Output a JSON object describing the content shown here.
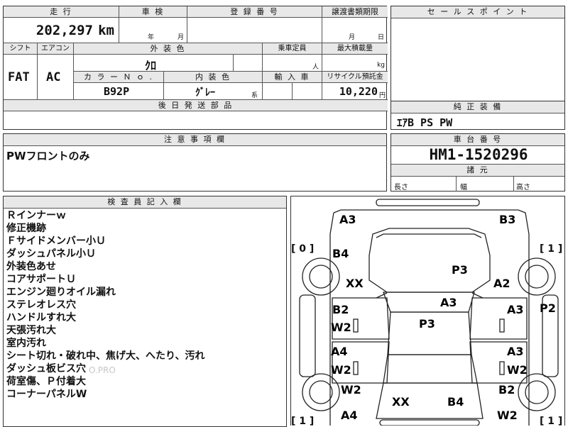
{
  "sheet": {
    "mileage_hdr": "走 行",
    "mileage": "202,297",
    "mileage_unit": "km",
    "inspection_hdr": "車 検",
    "inspection_year": "年",
    "inspection_month": "月",
    "reg_hdr": "登 録 番 号",
    "transfer_hdr": "譲渡書類期限",
    "transfer_month": "月",
    "transfer_day": "日",
    "shift_hdr": "シフト",
    "aircon_hdr": "エアコン",
    "color_hdr": "外 装 色",
    "capacity_hdr": "乗車定員",
    "load_hdr": "最大積載量",
    "shift": "FAT",
    "aircon": "AC",
    "color": "ｸﾛ",
    "capacity_unit": "人",
    "load_unit": "kg",
    "colorno_hdr": "カ ラ ー Ｎ ｏ .",
    "interior_hdr": "内 装 色",
    "import_hdr": "輸 入 車",
    "recycle_hdr": "リサイクル預託金",
    "colorno": "B92P",
    "interior": "ｸﾞﾚｰ",
    "interior_unit": "系",
    "recycle": "10,220",
    "recycle_unit": "円",
    "parts_hdr": "後 日 発 送 部 品"
  },
  "sales": {
    "hdr": "セ ー ル ス ポ イ ン ト"
  },
  "equip": {
    "hdr": "純 正 装 備",
    "value": "ｴｱB PS PW"
  },
  "notes": {
    "hdr": "注 意 事 項 欄",
    "value": "PWフロントのみ"
  },
  "chassis": {
    "hdr": "車 台 番 号",
    "value": "HM1-1520296",
    "dims_hdr": "諸 元",
    "length": "長さ",
    "width": "幅",
    "height": "高さ"
  },
  "inspector": {
    "hdr": "検 査 員 記 入 欄",
    "lines": [
      "Ｒインナーｗ",
      "修正機跡",
      "Ｆサイドメンバー小Ｕ",
      "ダッシュパネル小Ｕ",
      "外装色あせ",
      "コアサポートＵ",
      "エンジン廻りオイル漏れ",
      "ステレオレス穴",
      "ハンドルすれ大",
      "天張汚れ大",
      "室内汚れ",
      "シート切れ・破れ中、焦げ大、へたり、汚れ",
      "ダッシュ板ビス穴",
      "荷室傷、Ｐ付着大",
      "コーナーパネルW"
    ]
  },
  "watermark": "O.PRO",
  "diagram": {
    "codes": {
      "a3_front_left": "A3",
      "b3_front_right": "B3",
      "b4_left": "B4",
      "p3_hood": "P3",
      "xx_left": "XX",
      "a2_right": "A2",
      "a3_center": "A3",
      "p3_roof": "P3",
      "b2_left_front_door": "B2",
      "w2_left_front_door": "W2",
      "a3_right_front_door": "A3",
      "p2_right_side": "P2",
      "a4_left_rear_door": "A4",
      "w2_left_rear_door": "W2",
      "a3_right_rear_door": "A3",
      "w2_right_rear_door": "W2",
      "w2_left_rear": "W2",
      "b2_right_rear": "B2",
      "xx_rear": "XX",
      "b4_rear": "B4",
      "a4_rear_left": "A4",
      "w2_rear_right": "W2"
    },
    "tires": {
      "front_left": "[ 0 ]",
      "front_right": "[ 1 ]",
      "rear_left": "[ 1 ]",
      "rear_right": "[ 1 ]"
    }
  }
}
